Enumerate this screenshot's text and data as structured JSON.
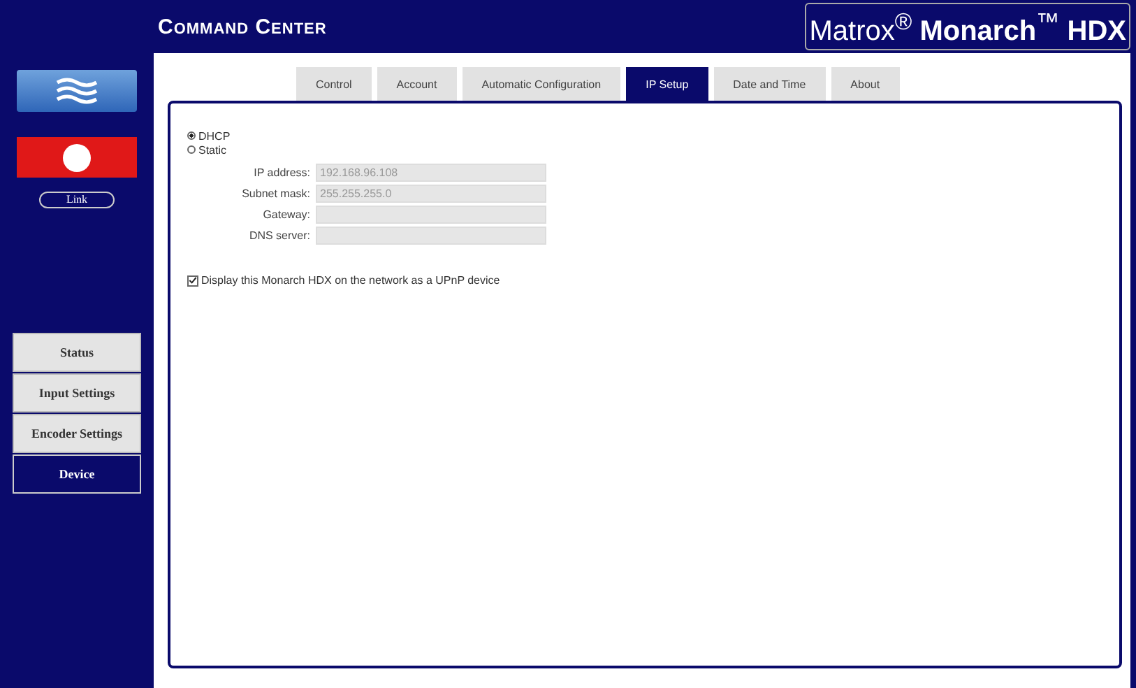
{
  "header": {
    "title": "Command Center",
    "logo": "Matrox$^{®}$ **Monarch**$^{™}$ **HDX**"
  },
  "sidebar": {
    "link_button": "Link",
    "recording": true,
    "items": [
      {
        "label": "Status",
        "selected": false
      },
      {
        "label": "Input Settings",
        "selected": false
      },
      {
        "label": "Encoder Settings",
        "selected": false
      },
      {
        "label": "Device",
        "selected": true
      }
    ]
  },
  "tabs": [
    {
      "label": "Control",
      "selected": false
    },
    {
      "label": "Account",
      "selected": false
    },
    {
      "label": "Automatic Configuration",
      "selected": false
    },
    {
      "label": "IP Setup",
      "selected": true
    },
    {
      "label": "Date and Time",
      "selected": false
    },
    {
      "label": "About",
      "selected": false
    }
  ],
  "addressing": [
    {
      "label": "DHCP",
      "selected": true
    },
    {
      "label": "Static",
      "selected": false
    }
  ],
  "fields": [
    {
      "label": "IP address:",
      "value": "192.168.96.108",
      "disabled": true
    },
    {
      "label": "Subnet mask:",
      "value": "255.255.255.0",
      "disabled": true
    },
    {
      "label": "Gateway:",
      "disabled": true
    },
    {
      "label": "DNS server:",
      "disabled": true
    }
  ],
  "upnp": {
    "label": "Display this Monarch HDX on the network as a UPnP device",
    "checked": true
  }
}
